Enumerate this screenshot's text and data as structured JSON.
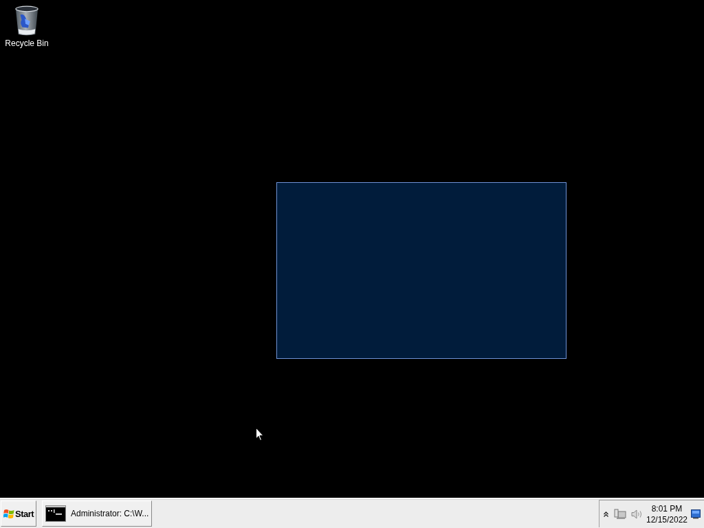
{
  "desktop": {
    "icons": [
      {
        "kind": "recycle-bin",
        "label": "Recycle Bin"
      }
    ]
  },
  "taskbar": {
    "start_button": {
      "label": "Start"
    },
    "buttons": [
      {
        "kind": "console",
        "label": "Administrator: C:\\W...",
        "selected": false
      }
    ],
    "tray": {
      "time": "8:01 PM",
      "date": "12/15/2022"
    }
  }
}
